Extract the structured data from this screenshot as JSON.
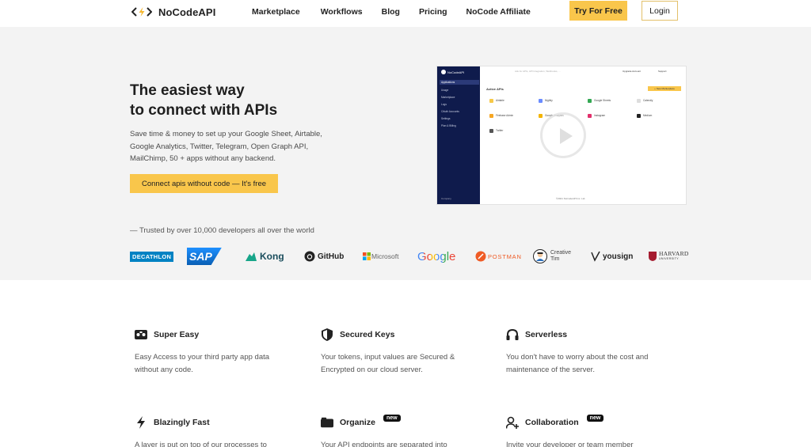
{
  "nav": {
    "logo_text": "NoCodeAPI",
    "links": [
      "Marketplace",
      "Workflows",
      "Blog",
      "Pricing",
      "NoCode Affiliate"
    ],
    "try_label": "Try For Free",
    "login_label": "Login"
  },
  "hero": {
    "title_line1": "The easiest way",
    "title_line2": "to connect with APIs",
    "description": "Save time & money to set up your Google Sheet, Airtable, Google Analytics, Twitter, Telegram, Open Graph API, MailChimp, 50 + apps without any backend.",
    "cta_label": "Connect apis without code — It's free",
    "trusted_text": "— Trusted by over 10,000 developers all over the world"
  },
  "mock": {
    "brand": "NoCodeAPI",
    "search_placeholder": "Ask for APIs, API Integration, Webhooks, ...",
    "upgrade": "Upgrade Account",
    "support": "Support",
    "heading": "Active APIs",
    "new_button": "+ New Marketplace",
    "sidebar_items": [
      "Applications",
      "Usage",
      "Marketplace",
      "Logs",
      "OAuth Accounts",
      "Settings",
      "Plan & Billing"
    ],
    "cards": [
      "Airtable",
      "Nightly",
      "Google Sheets",
      "Calendly",
      "Firebase Admin",
      "Google Analytics",
      "Instagram",
      "Medium",
      "Twitter"
    ],
    "footer": "©2021 NoCodeAPI Inc. Ltd.",
    "company": "Company"
  },
  "brands": [
    {
      "name": "DECATHLON",
      "color": "#0082c3"
    },
    {
      "name": "SAP",
      "color": "#0a6ed1"
    },
    {
      "name": "Kong",
      "color": "#1a4d5c"
    },
    {
      "name": "GitHub",
      "color": "#222222"
    },
    {
      "name": "Microsoft",
      "color": "#666666"
    },
    {
      "name": "Google",
      "color": "#4285f4"
    },
    {
      "name": "POSTMAN",
      "color": "#ef5b25"
    },
    {
      "name": "Creative",
      "color": "#444444"
    },
    {
      "name": "Tim",
      "color": "#444444"
    },
    {
      "name": "yousign",
      "color": "#222222"
    },
    {
      "name": "HARVARD",
      "color": "#a51c30"
    },
    {
      "name": "UNIVERSITY",
      "color": "#a51c30"
    }
  ],
  "features": [
    {
      "title": "Super Easy",
      "desc": "Easy Access to your third party app data without any code.",
      "icon": "controller-icon",
      "badge": ""
    },
    {
      "title": "Secured Keys",
      "desc": "Your tokens, input values are Secured & Encrypted on our cloud server.",
      "icon": "shield-icon",
      "badge": ""
    },
    {
      "title": "Serverless",
      "desc": "You don't have to worry about the cost and maintenance of the server.",
      "icon": "headphones-icon",
      "badge": ""
    },
    {
      "title": "Blazingly Fast",
      "desc": "A layer is put on top of our processes to",
      "icon": "bolt-icon",
      "badge": ""
    },
    {
      "title": "Organize",
      "desc": "Your API endpoints are separated into",
      "icon": "folder-icon",
      "badge": "new"
    },
    {
      "title": "Collaboration",
      "desc": "Invite your developer or team member",
      "icon": "user-plus-icon",
      "badge": "new"
    }
  ]
}
